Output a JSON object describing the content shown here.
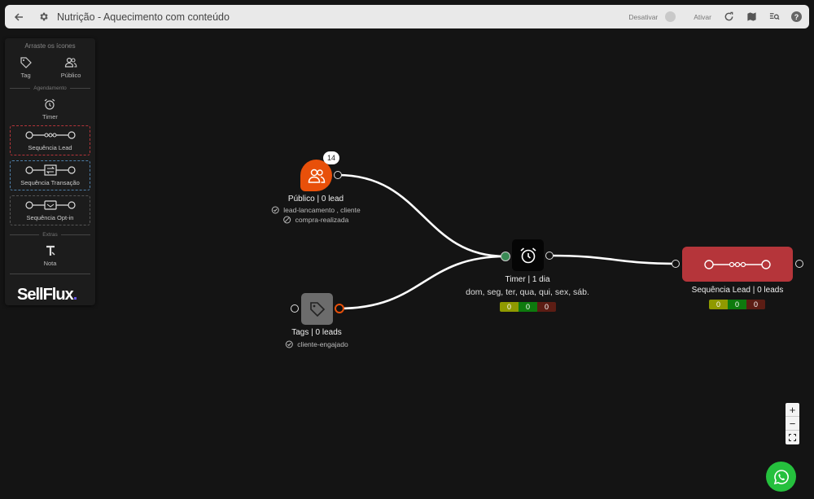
{
  "topbar": {
    "title": "Nutrição - Aquecimento com conteúdo",
    "deactivate_label": "Desativar",
    "activate_label": "Ativar",
    "help_label": "?"
  },
  "palette": {
    "header": "Arraste os ícones",
    "tag_label": "Tag",
    "public_label": "Público",
    "scheduling_label": "Agendamento",
    "timer_label": "Timer",
    "seq_lead_label": "Sequência Lead",
    "seq_transaction_label": "Sequência Transação",
    "seq_optin_label": "Sequência Opt-in",
    "extras_label": "Extras",
    "note_label": "Nota",
    "logo_text": "SellFlux",
    "logo_dot": "."
  },
  "nodes": {
    "publico": {
      "badge": "14",
      "title": "Público | 0 lead",
      "include": "lead-lancamento , cliente",
      "exclude": "compra-realizada",
      "color": "#e8500a"
    },
    "tags": {
      "title": "Tags | 0 leads",
      "include": "cliente-engajado"
    },
    "timer": {
      "title": "Timer | 1 dia",
      "days": "dom, seg, ter, qua, qui, sex, sáb.",
      "counts": [
        "0",
        "0",
        "0"
      ]
    },
    "sequence": {
      "title": "Sequência Lead | 0 leads",
      "counts": [
        "0",
        "0",
        "0"
      ],
      "color": "#b5353a"
    }
  },
  "zoom": {
    "in": "+",
    "out": "−"
  },
  "colors": {
    "canvas": "#141414",
    "accent": "#6b5bff",
    "whatsapp": "#25c03d"
  }
}
